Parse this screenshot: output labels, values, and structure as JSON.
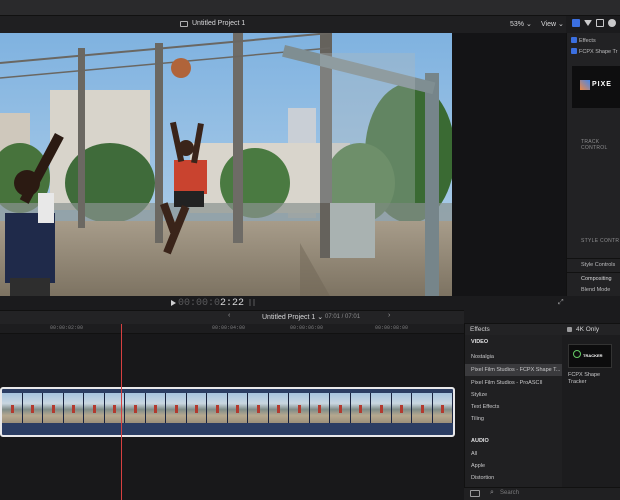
{
  "viewer": {
    "project_title": "Untitled Project 1",
    "zoom": "53%",
    "view_menu": "View",
    "timecode_dim": "00:00:0",
    "timecode_bright": "2:22"
  },
  "inspector": {
    "effects_label": "Effects",
    "plugin_label": "FCPX Shape Tr",
    "logo_text": "PIXE",
    "track_controls": "TRACK CONTROL",
    "style_controls_header": "STYLE CONTR",
    "style_controls": "Style Controls",
    "compositing": "Compositing",
    "blend_mode": "Blend Mode"
  },
  "timeline": {
    "title": "Untitled Project 1",
    "duration": "07:01 / 07:01",
    "ruler": [
      "00:00:02:00",
      "00:00:04:00",
      "00:00:06:00",
      "00:00:08:00"
    ]
  },
  "effects": {
    "header": "Effects",
    "filter": "4K Only",
    "items": [
      {
        "label": "VIDEO",
        "kind": "head"
      },
      {
        "label": "Nostalgia",
        "kind": "item"
      },
      {
        "label": "Pixel Film Studios - FCPX Shape T...",
        "kind": "selected"
      },
      {
        "label": "Pixel Film Studios - ProASCII",
        "kind": "item"
      },
      {
        "label": "Stylize",
        "kind": "item"
      },
      {
        "label": "Text Effects",
        "kind": "item"
      },
      {
        "label": "Tiling",
        "kind": "item"
      },
      {
        "label": "AUDIO",
        "kind": "head"
      },
      {
        "label": "All",
        "kind": "item"
      },
      {
        "label": "Apple",
        "kind": "item"
      },
      {
        "label": "Distortion",
        "kind": "item"
      }
    ],
    "thumb_caption": "FCPX Shape Tracker",
    "thumb_logo": "TRACKER",
    "search_placeholder": "Search"
  }
}
